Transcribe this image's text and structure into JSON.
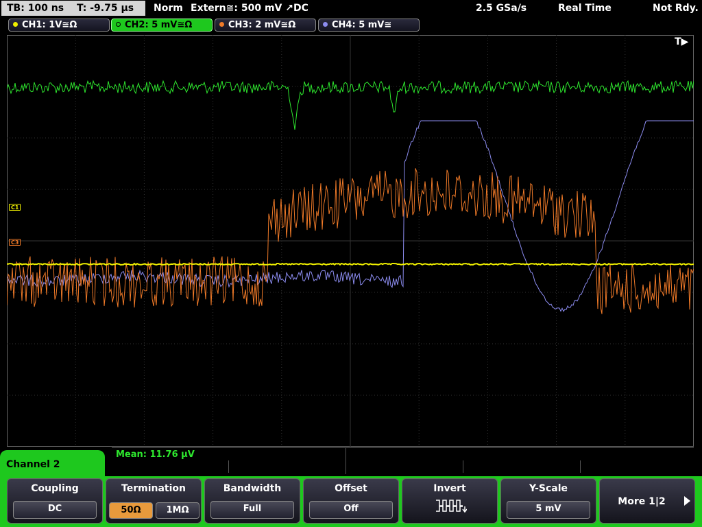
{
  "topbar": {
    "timebase": "TB: 100 ns",
    "trigger_time": "T: -9.75 µs",
    "mode": "Norm",
    "trigger": "Extern≅: 500 mV ↗DC",
    "sample_rate": "2.5 GSa/s",
    "acq_mode": "Real Time",
    "status": "Not Rdy."
  },
  "channels": [
    {
      "label": "CH1: 1V≅Ω",
      "color": "#f0f000"
    },
    {
      "label": "CH2: 5 mV≅Ω",
      "color": "#2ee82e"
    },
    {
      "label": "CH3: 2 mV≅Ω",
      "color": "#f07a28"
    },
    {
      "label": "CH4: 5 mV≅",
      "color": "#8c8cf0"
    }
  ],
  "markers": {
    "c1": "C1",
    "c3": "C3",
    "trigger": "T▶"
  },
  "measurement": {
    "text": "Mean: 11.76 µV"
  },
  "menu": {
    "channel_tab": "Channel 2",
    "coupling": {
      "title": "Coupling",
      "value": "DC"
    },
    "termination": {
      "title": "Termination",
      "opt1": "50Ω",
      "opt2": "1MΩ"
    },
    "bandwidth": {
      "title": "Bandwidth",
      "value": "Full"
    },
    "offset": {
      "title": "Offset",
      "value": "Off"
    },
    "invert": {
      "title": "Invert"
    },
    "yscale": {
      "title": "Y-Scale",
      "value": "5 mV"
    },
    "more": {
      "label": "More 1|2"
    }
  }
}
